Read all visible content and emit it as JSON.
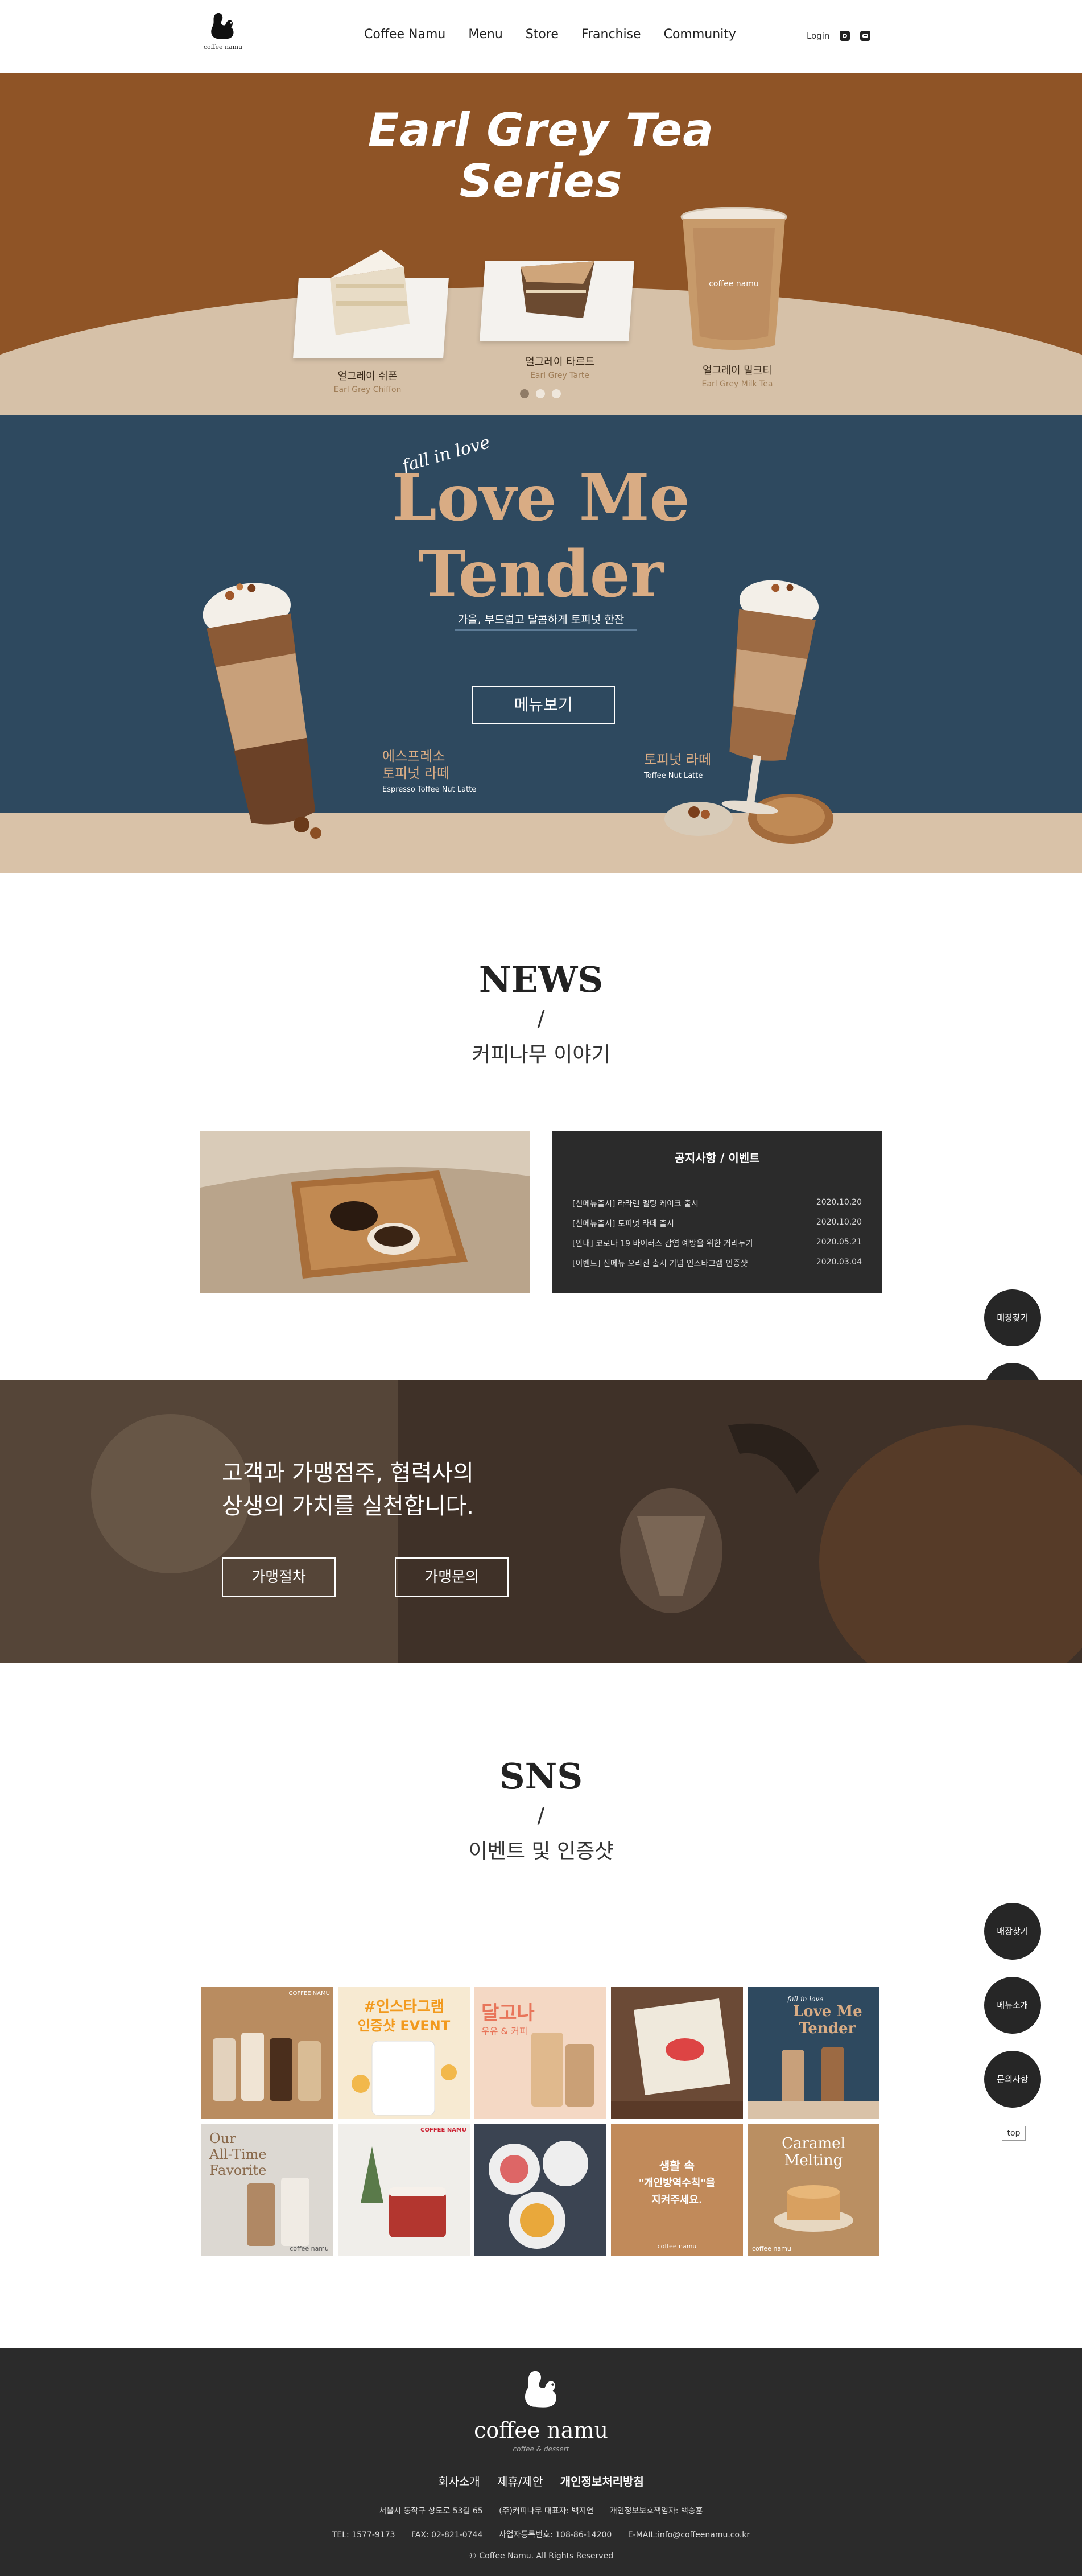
{
  "header": {
    "logo_text": "coffee namu",
    "nav": [
      "Coffee Namu",
      "Menu",
      "Store",
      "Franchise",
      "Community"
    ],
    "login": "Login"
  },
  "hero1": {
    "title_line1": "Earl Grey Tea",
    "title_line2": "Series",
    "products": [
      {
        "ko": "얼그레이 쉬폰",
        "en": "Earl Grey Chiffon"
      },
      {
        "ko": "얼그레이 타르트",
        "en": "Earl Grey Tarte"
      },
      {
        "ko": "얼그레이 밀크티",
        "en": "Earl Grey Milk Tea"
      }
    ],
    "cup_text": "coffee namu"
  },
  "hero2": {
    "script": "fall in love",
    "title_line1": "Love Me",
    "title_line2": "Tender",
    "subtitle": "가을, 부드럽고 달콤하게 토피넛 한잔",
    "button": "메뉴보기",
    "drink_left": {
      "ko1": "에스프레소",
      "ko2": "토피넛 라떼",
      "en": "Espresso Toffee Nut Latte"
    },
    "drink_right": {
      "ko": "토피넛 라떼",
      "en": "Toffee Nut Latte"
    }
  },
  "news": {
    "title": "NEWS",
    "slash": "/",
    "subtitle": "커피나무 이야기",
    "notice_head": "공지사항 / 이벤트",
    "items": [
      {
        "title": "[신메뉴출시] 라라랜 멜팅 케이크 출시",
        "date": "2020.10.20"
      },
      {
        "title": "[신메뉴출시] 토피넛 라떼 출시",
        "date": "2020.10.20"
      },
      {
        "title": "[안내] 코로나 19 바이러스 감염 예방을 위한 거리두기",
        "date": "2020.05.21"
      },
      {
        "title": "[이벤트] 신메뉴 오리진 출시 기념 인스타그램 인증샷",
        "date": "2020.03.04"
      }
    ]
  },
  "quick_nav": [
    "매장찾기",
    "메뉴소개",
    "문의사항"
  ],
  "top_label": "top",
  "franchise": {
    "line1": "고객과 가맹점주, 협력사의",
    "line2": "상생의 가치를 실천합니다.",
    "btn1": "가맹절차",
    "btn2": "가맹문의"
  },
  "sns": {
    "title": "SNS",
    "slash": "/",
    "subtitle": "이벤트 및 인증샷",
    "tile_texts": {
      "t1": "COFFEE NAMU",
      "t2a": "#인스타그램",
      "t2b": "인증샷 EVENT",
      "t3a": "달고나",
      "t3b": "우유 & 커피",
      "t5a": "fall in love",
      "t5b": "Love Me",
      "t5c": "Tender",
      "t6a": "Our",
      "t6b": "All-Time",
      "t6c": "Favorite",
      "t6d": "coffee namu",
      "t7": "COFFEE NAMU",
      "t9a": "생활 속",
      "t9b": "\"개인방역수칙\"을",
      "t9c": "지켜주세요.",
      "t9d": "coffee namu",
      "t10a": "Caramel",
      "t10b": "Melting",
      "t10c": "coffee namu"
    }
  },
  "footer": {
    "brand": "coffee namu",
    "tagline": "coffee & dessert",
    "links": [
      "회사소개",
      "제휴/제안",
      "개인정보처리방침"
    ],
    "address": [
      "서울시 동작구 상도로 53길 65",
      "(주)커피나무 대표자: 백지연",
      "개인정보보호책임자: 백승훈"
    ],
    "contact": [
      "TEL: 1577-9173",
      "FAX: 02-821-0744",
      "사업자등록번호: 108-86-14200",
      "E-MAIL:info@coffeenamu.co.kr"
    ],
    "copyright": "© Coffee Namu. All Rights Reserved"
  },
  "colors": {
    "hero1_bg": "#8f5426",
    "hero2_bg": "#2e495f",
    "accent_tan": "#d9ac84",
    "dark": "#2b2b2b"
  }
}
